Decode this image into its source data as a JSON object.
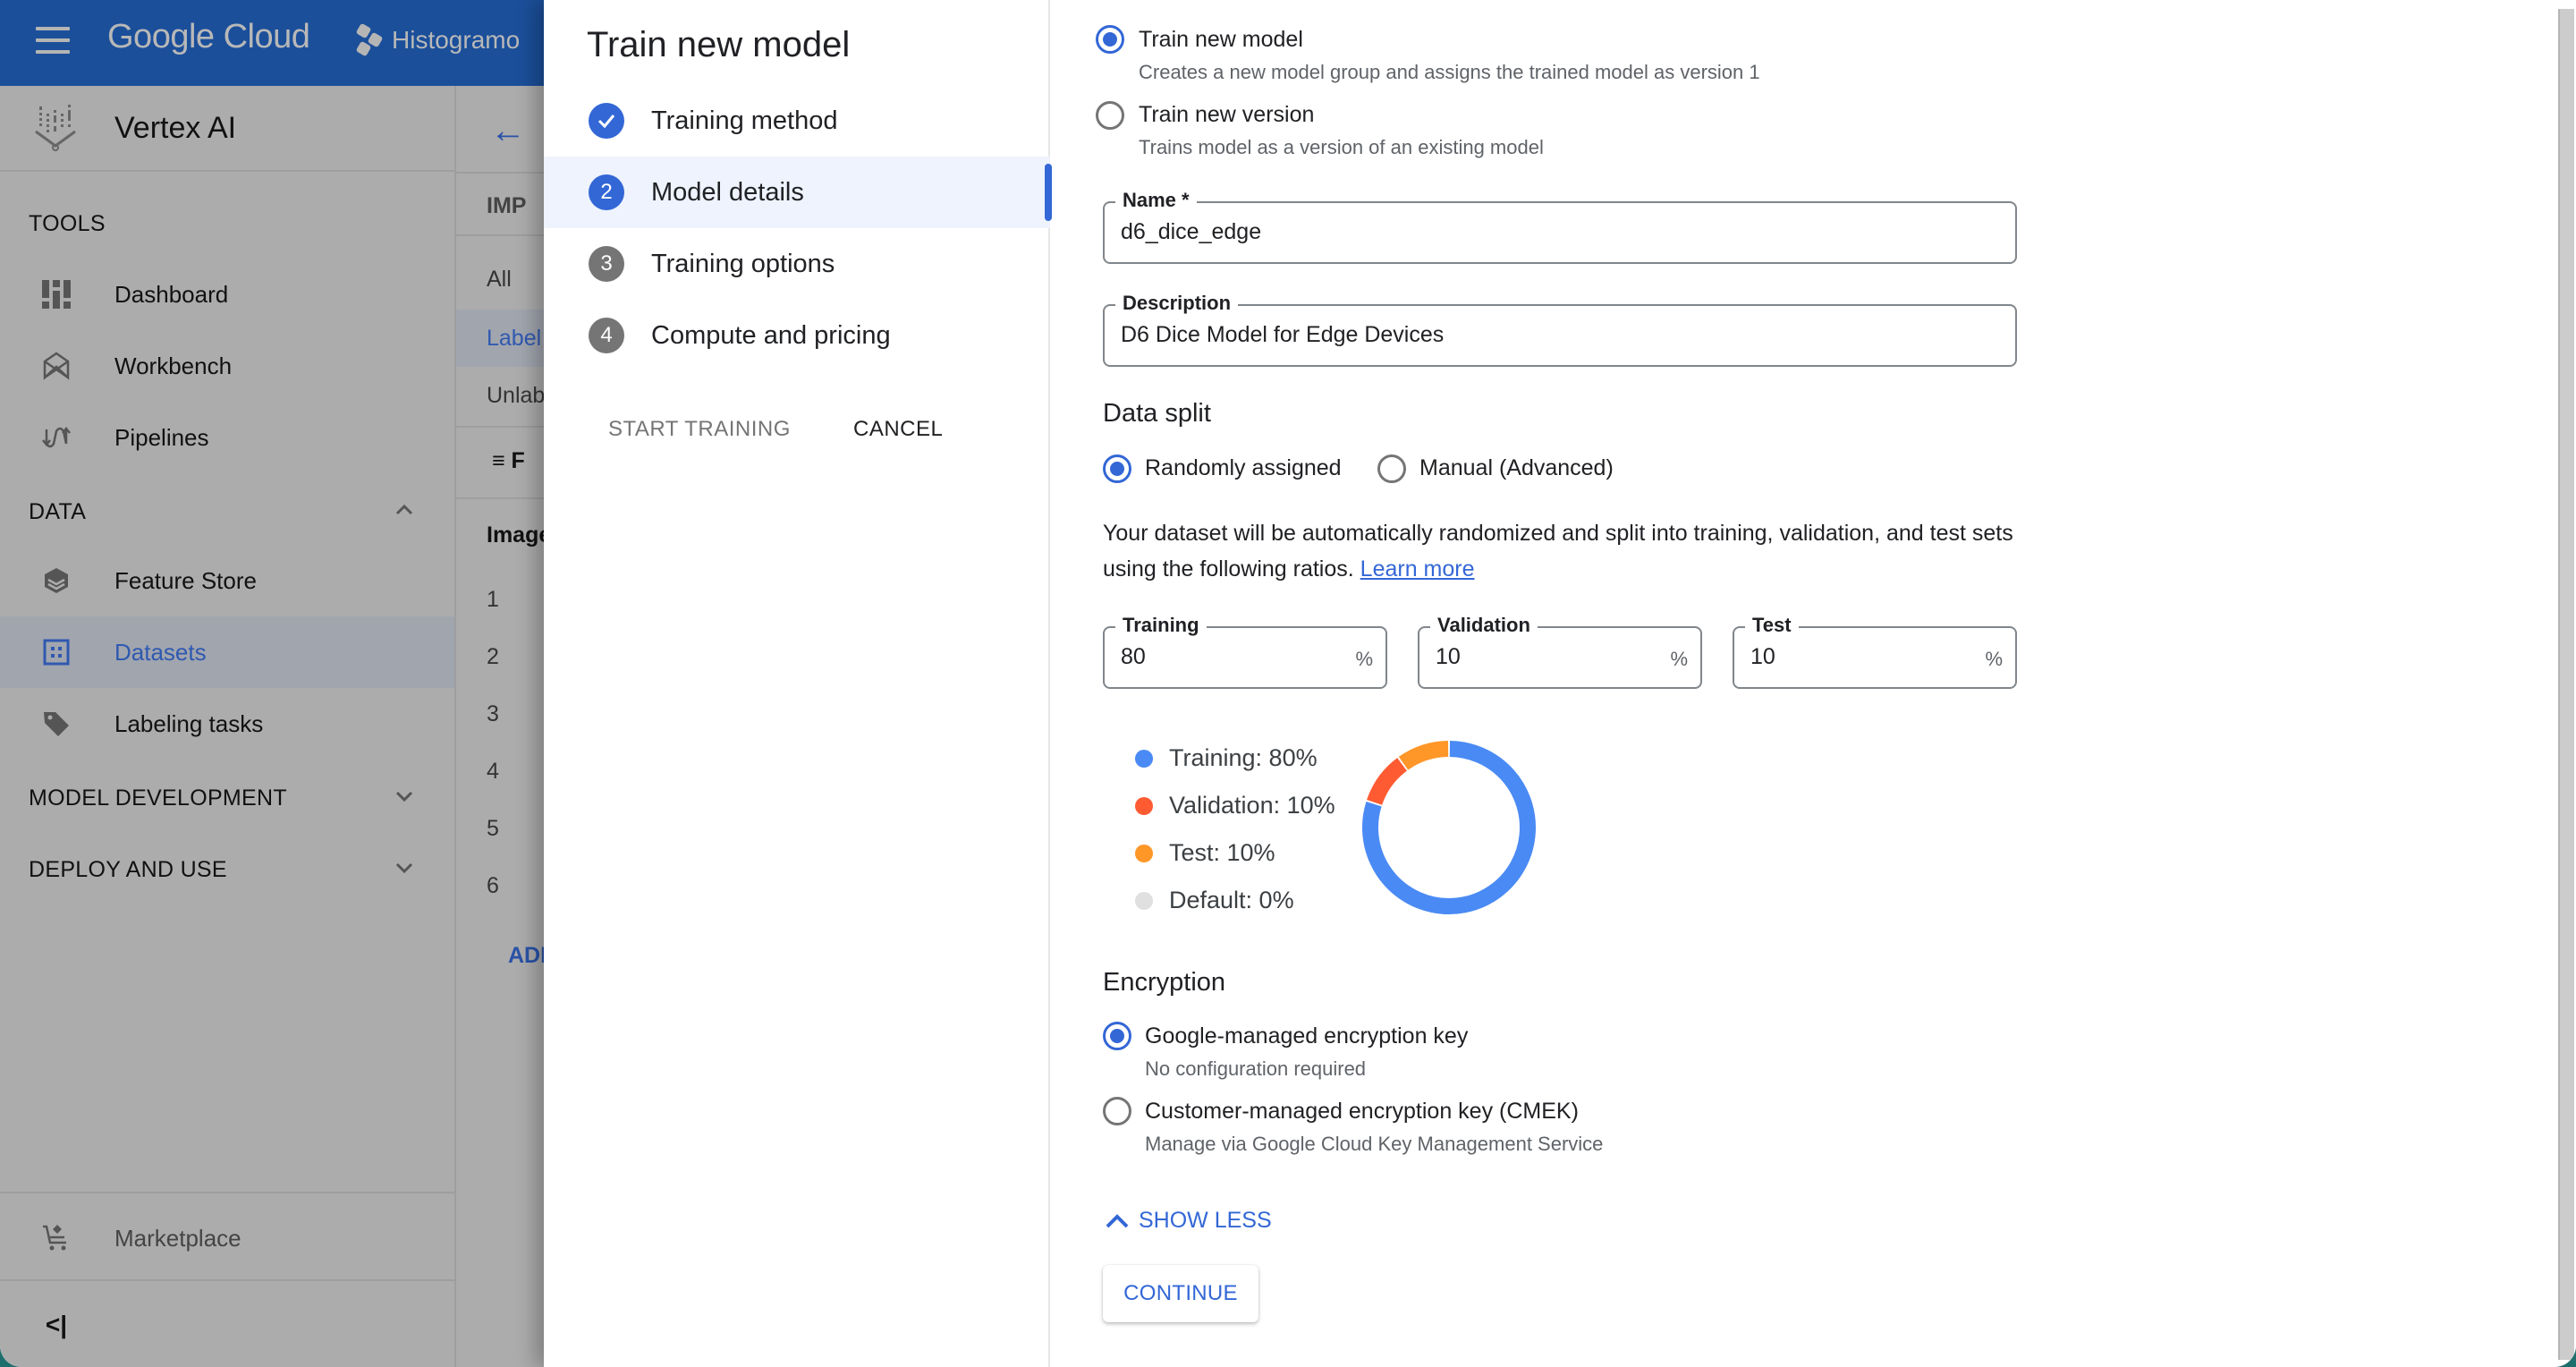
{
  "topbar": {
    "brand": "Google Cloud",
    "project": "Histogramo"
  },
  "sidebar": {
    "product": "Vertex AI",
    "sections": {
      "tools": "TOOLS",
      "data": "DATA",
      "model_development": "MODEL DEVELOPMENT",
      "deploy_and_use": "DEPLOY AND USE"
    },
    "items": [
      {
        "label": "Dashboard",
        "icon": "dashboard-icon"
      },
      {
        "label": "Workbench",
        "icon": "workbench-icon"
      },
      {
        "label": "Pipelines",
        "icon": "pipelines-icon"
      },
      {
        "label": "Feature Store",
        "icon": "feature-store-icon"
      },
      {
        "label": "Datasets",
        "icon": "datasets-icon",
        "active": true
      },
      {
        "label": "Labeling tasks",
        "icon": "label-icon"
      }
    ],
    "marketplace": "Marketplace",
    "collapse": "<|"
  },
  "background_panel": {
    "import_tab": "IMP",
    "filters": [
      "All",
      "Label",
      "Unlab"
    ],
    "filter_label": "F",
    "column_header": "Image",
    "rows": [
      "1",
      "2",
      "3",
      "4",
      "5",
      "6"
    ],
    "add_link": "ADD"
  },
  "dialog": {
    "title": "Train new model",
    "steps": [
      {
        "num": "1",
        "label": "Training method",
        "state": "done"
      },
      {
        "num": "2",
        "label": "Model details",
        "state": "current"
      },
      {
        "num": "3",
        "label": "Training options",
        "state": "todo"
      },
      {
        "num": "4",
        "label": "Compute and pricing",
        "state": "todo"
      }
    ],
    "start_training": "START TRAINING",
    "cancel": "CANCEL"
  },
  "form": {
    "model_type": {
      "options": [
        {
          "label": "Train new model",
          "sub": "Creates a new model group and assigns the trained model as version 1",
          "selected": true
        },
        {
          "label": "Train new version",
          "sub": "Trains model as a version of an existing model",
          "selected": false
        }
      ]
    },
    "name": {
      "label": "Name *",
      "value": "d6_dice_edge"
    },
    "description": {
      "label": "Description",
      "value": "D6 Dice Model for Edge Devices"
    },
    "data_split": {
      "heading": "Data split",
      "options": [
        {
          "label": "Randomly assigned",
          "selected": true
        },
        {
          "label": "Manual (Advanced)",
          "selected": false
        }
      ],
      "text": "Your dataset will be automatically randomized and split into training, validation, and test sets using the following ratios.",
      "learn_more": "Learn more",
      "fields": [
        {
          "label": "Training",
          "value": "80",
          "suffix": "%"
        },
        {
          "label": "Validation",
          "value": "10",
          "suffix": "%"
        },
        {
          "label": "Test",
          "value": "10",
          "suffix": "%"
        }
      ]
    },
    "encryption": {
      "heading": "Encryption",
      "options": [
        {
          "label": "Google-managed encryption key",
          "sub": "No configuration required",
          "selected": true
        },
        {
          "label": "Customer-managed encryption key (CMEK)",
          "sub": "Manage via Google Cloud Key Management Service",
          "selected": false
        }
      ]
    },
    "show_less": "SHOW LESS",
    "continue": "CONTINUE"
  },
  "chart_data": {
    "type": "pie",
    "donut": true,
    "title": "",
    "categories": [
      "Training",
      "Validation",
      "Test",
      "Default"
    ],
    "values": [
      80,
      10,
      10,
      0
    ],
    "legend": [
      "Training: 80%",
      "Validation: 10%",
      "Test: 10%",
      "Default: 0%"
    ],
    "colors": [
      "#4a8af4",
      "#ff5b33",
      "#ff9628",
      "#e0e0e0"
    ],
    "legend_position": "left"
  }
}
